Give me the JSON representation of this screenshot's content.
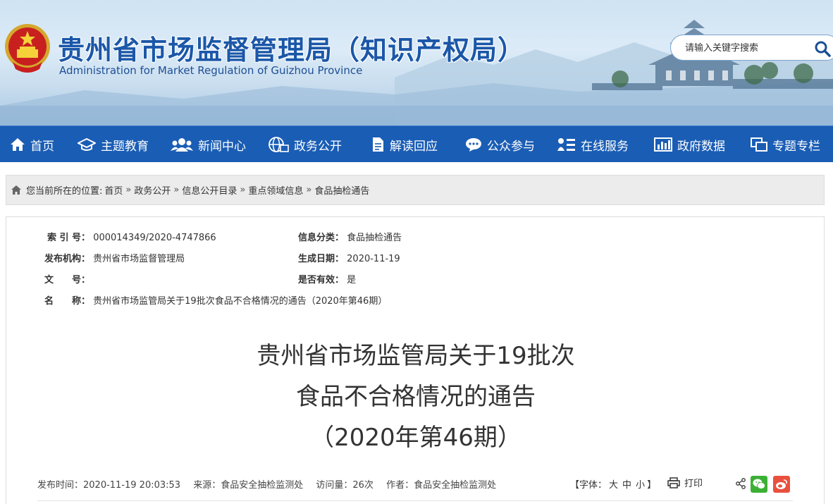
{
  "header": {
    "title": "贵州省市场监督管理局（知识产权局）",
    "subtitle": "Administration for Market Regulation of Guizhou Province",
    "search_placeholder": "请输入关键字搜索"
  },
  "nav": {
    "items": [
      {
        "label": "首页",
        "icon": "home-icon"
      },
      {
        "label": "主题教育",
        "icon": "graduation-cap-icon"
      },
      {
        "label": "新闻中心",
        "icon": "users-icon"
      },
      {
        "label": "政务公开",
        "icon": "globe-icon"
      },
      {
        "label": "解读回应",
        "icon": "document-icon"
      },
      {
        "label": "公众参与",
        "icon": "chat-bubble-icon"
      },
      {
        "label": "在线服务",
        "icon": "list-icon"
      },
      {
        "label": "政府数据",
        "icon": "bar-chart-icon"
      },
      {
        "label": "专题专栏",
        "icon": "windows-icon"
      }
    ]
  },
  "breadcrumb": {
    "prefix": "您当前所在的位置:",
    "items": [
      "首页",
      "政务公开",
      "信息公开目录",
      "重点领域信息",
      "食品抽检通告"
    ],
    "separator": "»"
  },
  "meta": {
    "index_label": "索 引 号：",
    "index_value": "000014349/2020-4747866",
    "category_label": "信息分类：",
    "category_value": "食品抽检通告",
    "publisher_label": "发布机构：",
    "publisher_value": "贵州省市场监督管理局",
    "date_label": "生成日期：",
    "date_value": "2020-11-19",
    "docno_label": "文　　号：",
    "docno_value": "",
    "valid_label": "是否有效：",
    "valid_value": "是",
    "name_label": "名　　称：",
    "name_value": "贵州省市场监管局关于19批次食品不合格情况的通告（2020年第46期）"
  },
  "article": {
    "title_line1": "贵州省市场监管局关于19批次",
    "title_line2": "食品不合格情况的通告",
    "title_line3": "（2020年第46期）",
    "publish_time": "发布时间：2020-11-19 20:03:53",
    "source": "来源：食品安全抽检监测处",
    "views": "访问量：26次",
    "author": "作者：食品安全抽检监测处",
    "font_label_open": "【字体：",
    "font_large": "大",
    "font_medium": "中",
    "font_small": "小",
    "font_label_close": "】",
    "print_label": "打印"
  },
  "colors": {
    "nav_bg": "#1a5db5",
    "title_blue": "#1b57a8",
    "wechat_green": "#3cb034",
    "weibo_red": "#e9503e"
  }
}
